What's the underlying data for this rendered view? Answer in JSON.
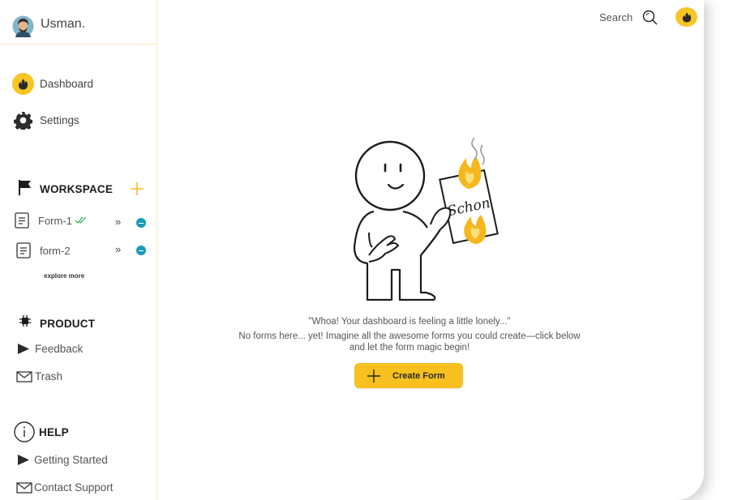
{
  "user": {
    "name": "Usman."
  },
  "nav": {
    "dashboard": "Dashboard",
    "settings": "Settings"
  },
  "workspace": {
    "title": "WORKSPACE",
    "forms": [
      {
        "label": "Form-1",
        "status": "checked"
      },
      {
        "label": "form-2",
        "status": ""
      }
    ],
    "explore_more": "explore more"
  },
  "product": {
    "title": "PRODUCT",
    "items": [
      "Feedback",
      "Trash"
    ]
  },
  "help": {
    "title": "HELP",
    "items": [
      "Getting Started",
      "Contact Support"
    ]
  },
  "topbar": {
    "search_label": "Search"
  },
  "main": {
    "message_title": "\"Whoa! Your dashboard is feeling a little lonely...\"",
    "message_line1": "No forms here... yet! Imagine all the awesome forms you could create—click below",
    "message_line2": "and let the form magic begin!",
    "illustration_text": "Schon",
    "create_button": "Create Form"
  },
  "colors": {
    "accent": "#f7c525",
    "remove": "#1a9bb8",
    "check": "#2fa84f"
  },
  "icons": {
    "dashboard": "flame-icon",
    "settings": "gear-icon",
    "workspace": "flag-icon",
    "add": "plus-icon",
    "form": "document-icon",
    "open": "double-chevron-right-icon",
    "remove": "minus-circle-icon",
    "product": "chip-icon",
    "feedback": "play-icon",
    "trash": "envelope-icon",
    "help": "info-icon",
    "search": "search-icon"
  }
}
